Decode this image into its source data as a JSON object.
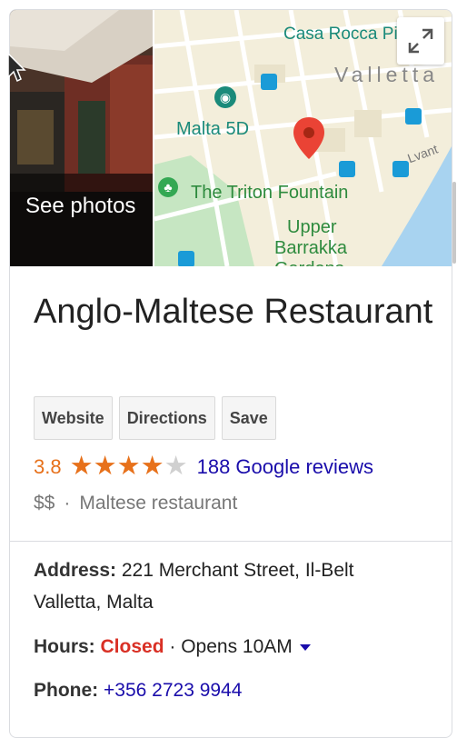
{
  "photo": {
    "label": "See photos"
  },
  "map": {
    "labels": {
      "casa_rocca": "Casa Rocca Piccola",
      "valletta": "Valletta",
      "malta5d": "Malta 5D",
      "triton": "The Triton Fountain",
      "upper": "Upper",
      "barrakka": "Barrakka",
      "gardens": "Gardens",
      "lvant": "Lvant"
    }
  },
  "place": {
    "name": "Anglo-Maltese Restaurant",
    "buttons": {
      "website": "Website",
      "directions": "Directions",
      "save": "Save"
    },
    "rating": "3.8",
    "rating_value": 3.8,
    "stars_max": 5,
    "reviews": "188 Google reviews",
    "price": "$$",
    "separator": "·",
    "category": "Maltese restaurant"
  },
  "info": {
    "address_label": "Address:",
    "address_line1": "221 Merchant Street, Il-Belt",
    "address_line2": "Valletta, Malta",
    "hours_label": "Hours:",
    "hours_status": "Closed",
    "hours_sep": "·",
    "hours_next": "Opens 10AM",
    "phone_label": "Phone:",
    "phone": "+356 2723 9944"
  },
  "colors": {
    "accent_orange": "#e7711b",
    "link_blue": "#1a0dab",
    "closed_red": "#d93025",
    "map_label_teal": "#1a8a7a",
    "map_label_green": "#2e8b3e",
    "pin_red": "#ea4335"
  }
}
